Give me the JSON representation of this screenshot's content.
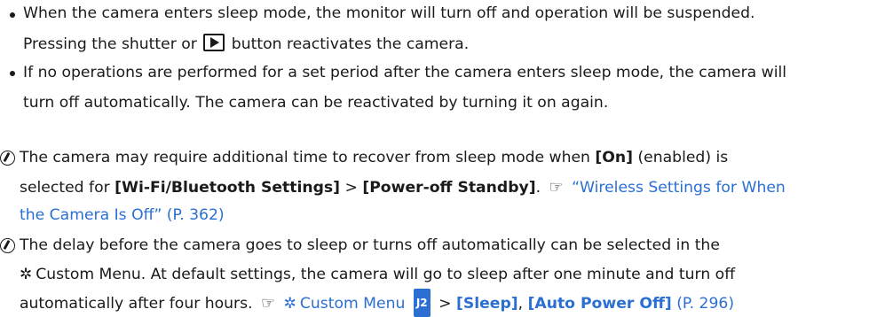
{
  "bullets": [
    {
      "line1": "When the camera enters sleep mode, the monitor will turn off and operation will be suspended.",
      "line2_pre": "Pressing the shutter or",
      "line2_post": "button reactivates the camera."
    },
    {
      "line1": "If no operations are performed for a set period after the camera enters sleep mode, the camera will",
      "line2": "turn off automatically. The camera can be reactivated by turning it on again."
    }
  ],
  "note1": {
    "l1_a": "The camera may require additional time to recover from sleep mode when ",
    "l1_b": "[On]",
    "l1_c": " (enabled) is",
    "l2_a": "selected for ",
    "l2_b": "[Wi-Fi/Bluetooth Settings]",
    "l2_c": " > ",
    "l2_d": "[Power-off Standby]",
    "l2_e": ".",
    "ref_icon": "☞",
    "link1": "“Wireless Settings for When",
    "link2": "the Camera Is Off” (P. 362)"
  },
  "note2": {
    "l1": "The delay before the camera goes to sleep or turns off automatically can be selected in the",
    "gear_icon": "✲",
    "l2": "Custom Menu. At default settings, the camera will go to sleep after one minute and turn off",
    "l3": "automatically after four hours.",
    "ref_icon": "☞",
    "menu_link": "Custom Menu",
    "j2_label": "J2",
    "sep": " > ",
    "sleep": "[Sleep]",
    "comma": ", ",
    "apo": "[Auto Power Off]",
    "page": " (P. 296)"
  }
}
